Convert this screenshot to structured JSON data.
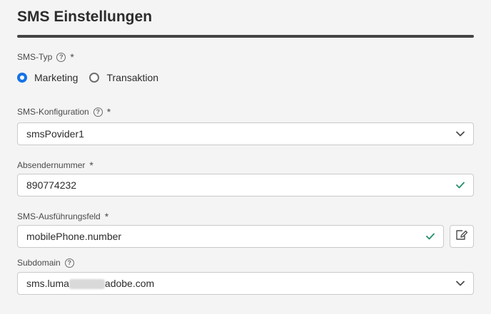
{
  "title": "SMS Einstellungen",
  "sms_type": {
    "label": "SMS-Typ",
    "required": "*",
    "options": [
      {
        "label": "Marketing",
        "selected": true
      },
      {
        "label": "Transaktion",
        "selected": false
      }
    ]
  },
  "sms_config": {
    "label": "SMS-Konfiguration",
    "required": "*",
    "value": "smsPovider1"
  },
  "sender_number": {
    "label": "Absendernummer",
    "required": "*",
    "value": "890774232"
  },
  "execution_field": {
    "label": "SMS-Ausführungsfeld",
    "required": "*",
    "value": "mobilePhone.number"
  },
  "subdomain": {
    "label": "Subdomain",
    "value_prefix": "sms.luma",
    "value_suffix": "adobe.com"
  },
  "colors": {
    "accent": "#1473e6",
    "valid": "#268e6c",
    "background": "#f4f4f4"
  },
  "icons": {
    "help": "help-icon",
    "chevron": "chevron-down-icon",
    "check": "checkmark-icon",
    "edit": "edit-icon"
  }
}
